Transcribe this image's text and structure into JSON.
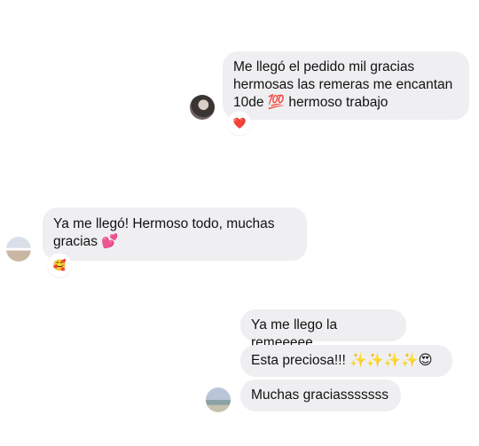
{
  "conversation": {
    "group1": {
      "message": "Me llegó el pedido mil gracias\nhermosas las remeras me encantan\n10de 💯 hermoso trabajo",
      "reaction": "❤️"
    },
    "group2": {
      "message": "Ya me llegó! Hermoso todo, muchas\ngracias 💕",
      "reaction": "🥰"
    },
    "group3": {
      "messages": [
        "Ya me llego la remeeeee",
        "Esta preciosa!!! ✨✨✨✨😍",
        "Muchas graciasssssss"
      ]
    }
  },
  "colors": {
    "bubble_bg": "#efeff2",
    "text": "#111111",
    "background": "#ffffff"
  }
}
